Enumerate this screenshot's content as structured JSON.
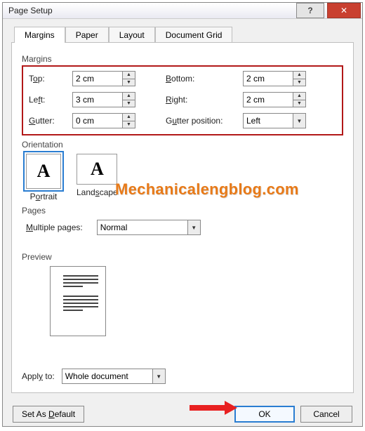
{
  "dialog": {
    "title": "Page Setup"
  },
  "tabs": {
    "margins": "Margins",
    "paper": "Paper",
    "layout": "Layout",
    "docgrid": "Document Grid"
  },
  "groups": {
    "margins": "Margins",
    "orientation": "Orientation",
    "pages": "Pages",
    "preview": "Preview"
  },
  "margins": {
    "top_label_pre": "T",
    "top_label_u": "o",
    "top_label_post": "p:",
    "top_value": "2 cm",
    "bottom_label_u": "B",
    "bottom_label_post": "ottom:",
    "bottom_value": "2 cm",
    "left_label_pre": "Le",
    "left_label_u": "f",
    "left_label_post": "t:",
    "left_value": "3 cm",
    "right_label_u": "R",
    "right_label_post": "ight:",
    "right_value": "2 cm",
    "gutter_label_u": "G",
    "gutter_label_post": "utter:",
    "gutter_value": "0 cm",
    "gutterpos_label_pre": "G",
    "gutterpos_label_u": "u",
    "gutterpos_label_post": "tter position:",
    "gutterpos_value": "Left"
  },
  "orientation": {
    "portrait_glyph": "A",
    "portrait_label_pre": "P",
    "portrait_label_u": "o",
    "portrait_label_post": "rtrait",
    "landscape_glyph": "A",
    "landscape_label_pre": "Land",
    "landscape_label_u": "s",
    "landscape_label_post": "cape"
  },
  "pages": {
    "multiple_label_u": "M",
    "multiple_label_post": "ultiple pages:",
    "multiple_value": "Normal"
  },
  "apply": {
    "label_pre": "Appl",
    "label_u": "y",
    "label_post": " to:",
    "value": "Whole document"
  },
  "buttons": {
    "default_pre": "Set As ",
    "default_u": "D",
    "default_post": "efault",
    "ok": "OK",
    "cancel": "Cancel"
  },
  "watermark": "Mechanicalengblog.com",
  "icons": {
    "help": "?",
    "close": "✕",
    "up": "▲",
    "down": "▼",
    "drop": "▼"
  }
}
